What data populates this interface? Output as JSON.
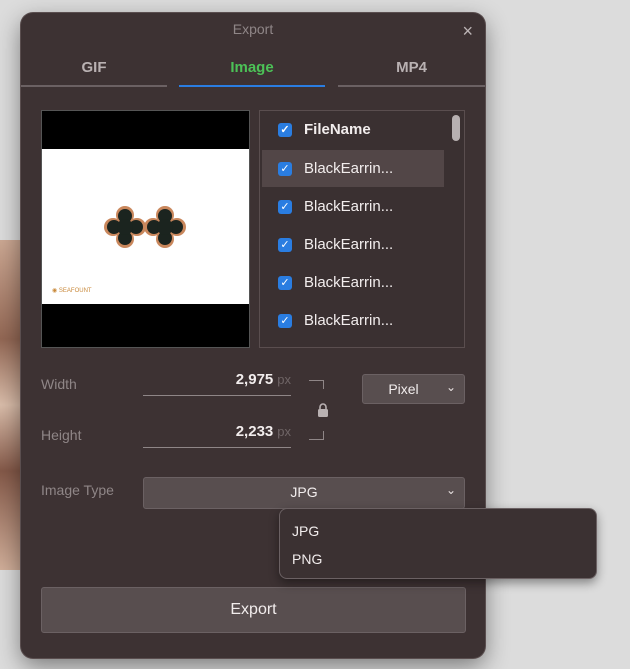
{
  "dialog": {
    "title": "Export",
    "close_glyph": "×"
  },
  "tabs": [
    {
      "label": "GIF",
      "active": false
    },
    {
      "label": "Image",
      "active": true
    },
    {
      "label": "MP4",
      "active": false
    }
  ],
  "preview": {
    "logo_text": "◉ SEAFOUNT",
    "earring_icon": "earring-icon"
  },
  "file_list": {
    "header": "FileName",
    "items": [
      "BlackEarrin...",
      "BlackEarrin...",
      "BlackEarrin...",
      "BlackEarrin...",
      "BlackEarrin..."
    ],
    "check_glyph": "✓"
  },
  "dimensions": {
    "width_label": "Width",
    "width_value": "2,975",
    "height_label": "Height",
    "height_value": "2,233",
    "unit": "px",
    "lock_icon": "lock-icon",
    "unit_select": "Pixel"
  },
  "image_type": {
    "label": "Image Type",
    "selected": "JPG",
    "options": [
      "JPG",
      "PNG"
    ]
  },
  "export_button": "Export",
  "colors": {
    "accent": "#2a7de1",
    "active_tab": "#4cc257",
    "panel": "#3d3233"
  }
}
